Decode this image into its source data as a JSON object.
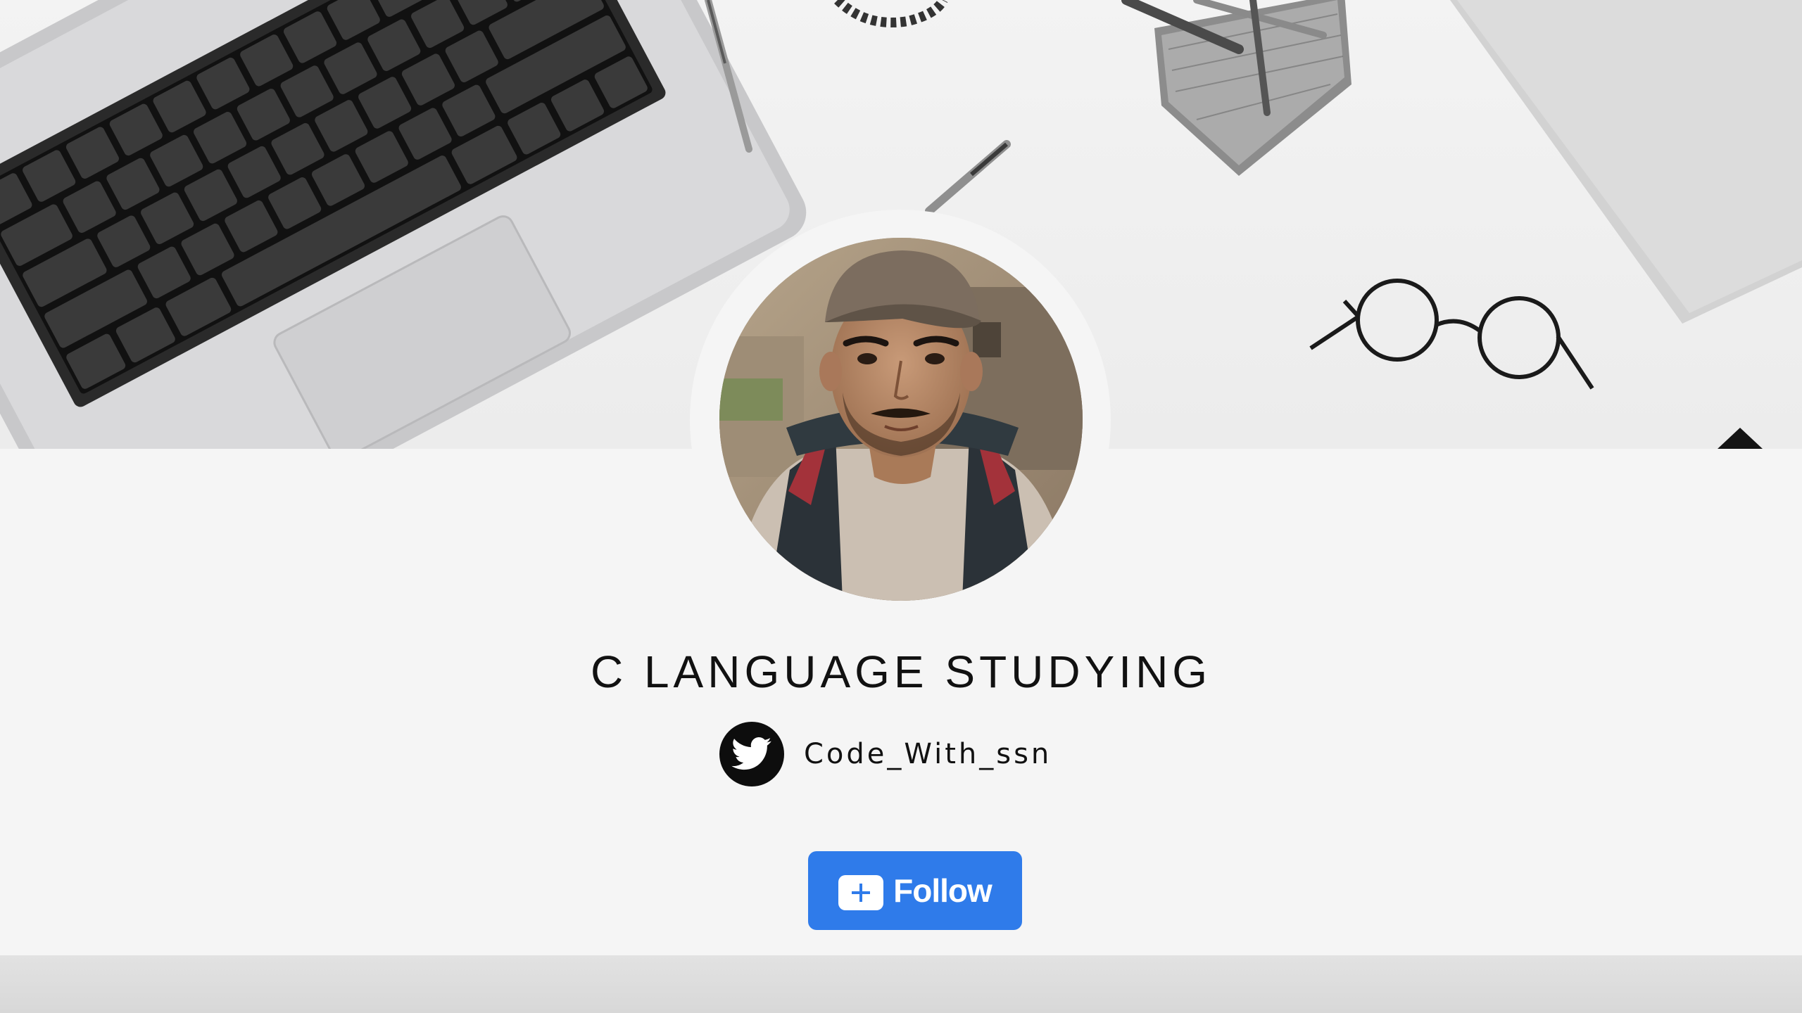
{
  "profile": {
    "title": "C LANGUAGE STUDYING",
    "twitter_handle": "Code_With_ssn",
    "avatar_alt": "profile photo"
  },
  "actions": {
    "follow_label": "Follow"
  },
  "icons": {
    "social": "twitter-icon",
    "follow": "plus-icon"
  },
  "colors": {
    "follow_button": "#2f7bea",
    "panel": "#f5f5f5",
    "text": "#111111"
  }
}
